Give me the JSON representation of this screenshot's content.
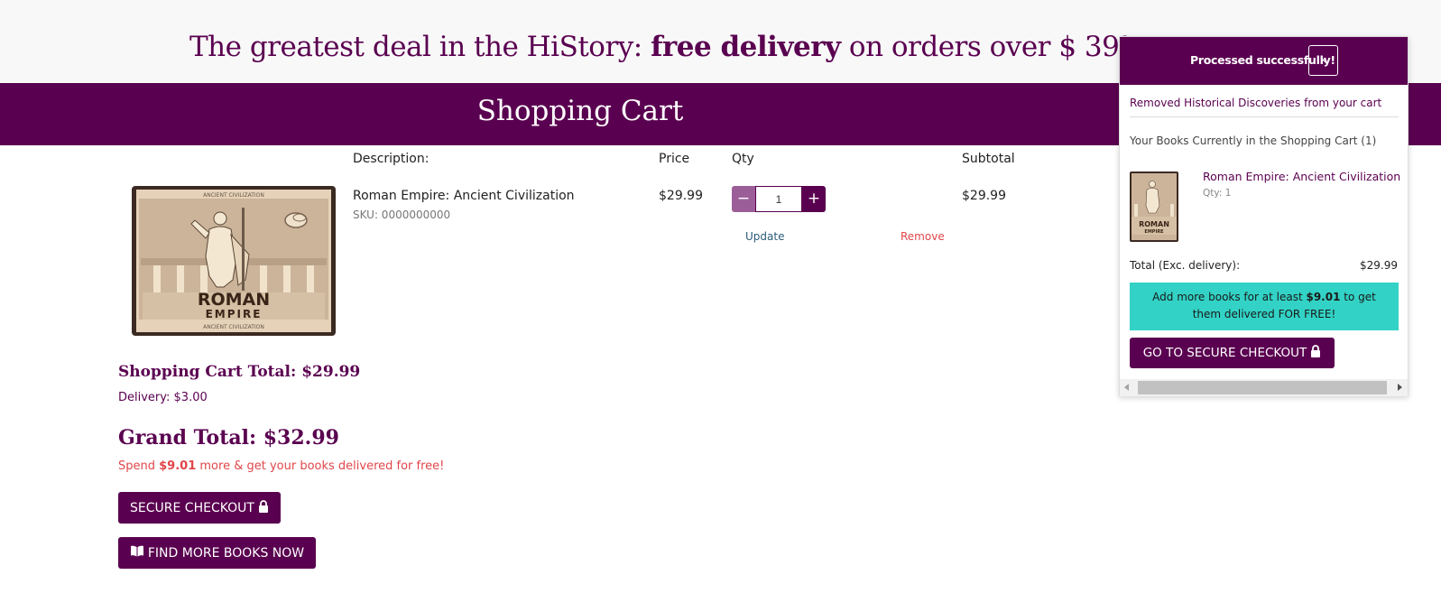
{
  "promo": {
    "prefix": "The greatest deal in the HiStory: ",
    "highlight": "free delivery",
    "suffix": " on orders over $ 39!"
  },
  "header": {
    "title": "Shopping Cart"
  },
  "table": {
    "headers": {
      "description": "Description:",
      "price": "Price",
      "qty": "Qty",
      "subtotal": "Subtotal"
    }
  },
  "cart_item": {
    "title": "Roman Empire: Ancient Civilization",
    "sku": "SKU: 0000000000",
    "price": "$29.99",
    "quantity": "1",
    "subtotal": "$29.99",
    "update_label": "Update",
    "remove_label": "Remove",
    "cover": {
      "top_text": "ANCIENT CIVILIZATION",
      "title_line1": "ROMAN",
      "title_line2": "EMPIRE",
      "bottom_text": "ANCIENT CIVILIZATION"
    }
  },
  "summary": {
    "cart_total": "Shopping Cart Total: $29.99",
    "delivery": "Delivery: $3.00",
    "grand_total": "Grand Total: $32.99",
    "spend_prefix": "Spend ",
    "spend_amount": "$9.01",
    "spend_suffix": " more & get your books delivered for free!"
  },
  "buttons": {
    "secure_checkout": "SECURE CHECKOUT",
    "find_more_books": "FIND MORE BOOKS NOW"
  },
  "toast": {
    "title": "Processed successfully!",
    "close": "×",
    "message": "Removed Historical Discoveries from your cart",
    "books_heading": "Your Books Currently in the Shopping Cart (1)",
    "item_title": "Roman Empire: Ancient Civilization",
    "item_qty": "Qty: 1",
    "total_label": "Total (Exc. delivery):",
    "total_value": "$29.99",
    "info_prefix": "Add more books for at least ",
    "info_amount": "$9.01",
    "info_middle": " to get them delivered ",
    "info_emphasis": "FOR FREE!",
    "checkout_label": "GO TO SECURE CHECKOUT"
  },
  "icons": {
    "lock": "lock-icon",
    "book": "book-open-icon",
    "minus": "minus-icon",
    "plus": "plus-icon",
    "close": "close-icon"
  },
  "colors": {
    "brand": "#5a0050",
    "accent_teal": "#32d3c6",
    "alert_red": "#e0464a",
    "link_blue": "#2c5d7a"
  }
}
